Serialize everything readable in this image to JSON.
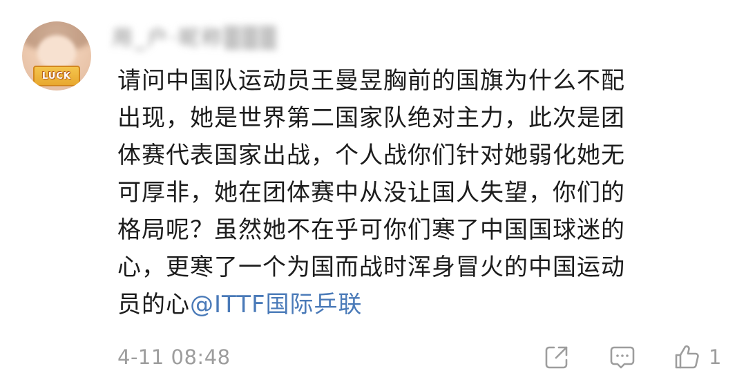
{
  "comment": {
    "avatar_badge": "LUCK",
    "username": "用_户·昵称▒▒▒",
    "text_lines": [
      "请问中国队运动员王曼昱胸前的国旗为什么不配",
      "出现，她是世界第二国家队绝对主力，此次是团",
      "体赛代表国家出战，个人战你们针对她弱化她无",
      "可厚非，她在团体赛中从没让国人失望，你们的",
      "格局呢？虽然她不在乎可你们寒了中国国球迷的",
      "心，更寒了一个为国而战时浑身冒火的中国运动"
    ],
    "last_line_text": "员的心",
    "mention": "@ITTF国际乒联",
    "timestamp": "4-11 08:48",
    "like_count": "1",
    "icons": {
      "share": "share-icon",
      "reply": "comment-icon",
      "like": "thumbs-up-icon"
    },
    "colors": {
      "text": "#1c1c1c",
      "meta": "#9d9d9d",
      "mention": "#4a7ab8"
    }
  }
}
